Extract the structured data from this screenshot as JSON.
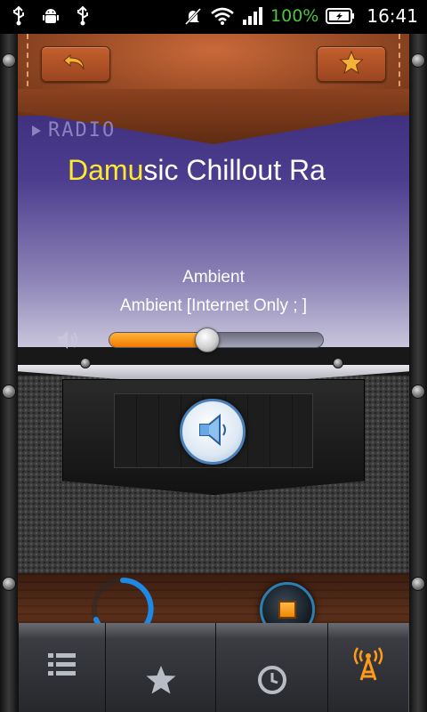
{
  "status_bar": {
    "battery_percent": "100%",
    "time": "16:41",
    "icons": [
      "usb-icon",
      "android-debug-icon",
      "usb-icon",
      "mute-icon",
      "wifi-icon",
      "signal-icon",
      "battery-icon"
    ]
  },
  "header": {
    "back_icon": "undo-arrow-icon",
    "favorite_icon": "star-icon"
  },
  "player": {
    "mode_label": "RADIO",
    "station_highlight": "Damu",
    "station_rest": "sic Chillout Ra",
    "genre": "Ambient",
    "description": "Ambient [Internet Only ; ]",
    "volume_level": 0.46,
    "accent_color": "#f08a00"
  },
  "controls": {
    "speaker_icon": "speaker-icon",
    "loading_icon": "spinner-icon",
    "stop_icon": "stop-icon"
  },
  "tabs": [
    {
      "id": "list",
      "icon": "list-icon"
    },
    {
      "id": "favorites",
      "icon": "star-icon"
    },
    {
      "id": "history",
      "icon": "clock-icon"
    },
    {
      "id": "radio",
      "icon": "radio-tower-icon",
      "active": true
    }
  ]
}
